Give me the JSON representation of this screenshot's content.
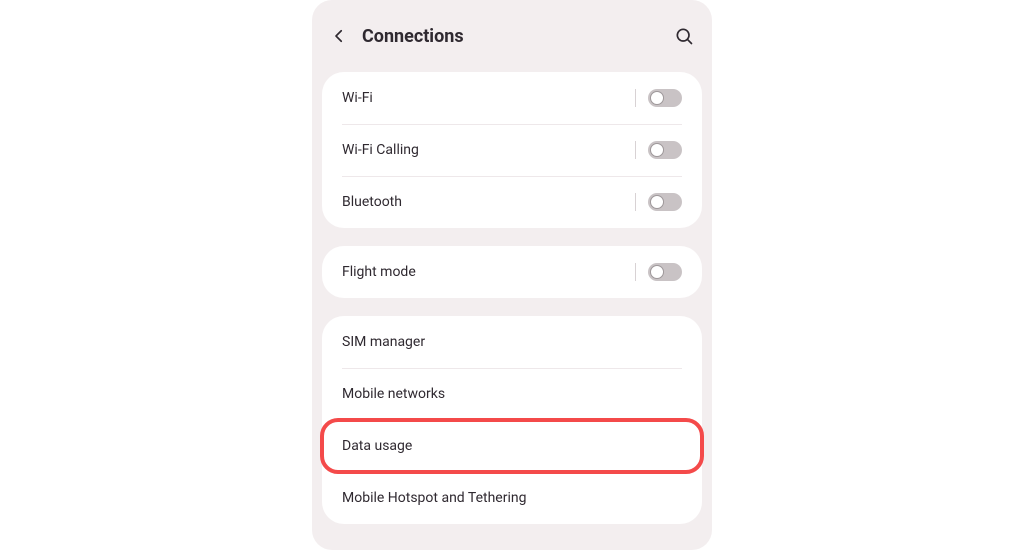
{
  "header": {
    "title": "Connections"
  },
  "groups": [
    {
      "rows": [
        {
          "label": "Wi-Fi",
          "toggle": true,
          "on": false,
          "name": "wifi"
        },
        {
          "label": "Wi-Fi Calling",
          "toggle": true,
          "on": false,
          "name": "wifi-calling"
        },
        {
          "label": "Bluetooth",
          "toggle": true,
          "on": false,
          "name": "bluetooth"
        }
      ]
    },
    {
      "rows": [
        {
          "label": "Flight mode",
          "toggle": true,
          "on": false,
          "name": "flight-mode"
        }
      ]
    },
    {
      "rows": [
        {
          "label": "SIM manager",
          "toggle": false,
          "name": "sim-manager"
        },
        {
          "label": "Mobile networks",
          "toggle": false,
          "name": "mobile-networks"
        },
        {
          "label": "Data usage",
          "toggle": false,
          "name": "data-usage",
          "highlighted": true
        },
        {
          "label": "Mobile Hotspot and Tethering",
          "toggle": false,
          "name": "mobile-hotspot-tethering"
        }
      ]
    }
  ],
  "colors": {
    "highlight": "#f44a4a",
    "phone_bg": "#f3eeef",
    "card_bg": "#ffffff"
  }
}
